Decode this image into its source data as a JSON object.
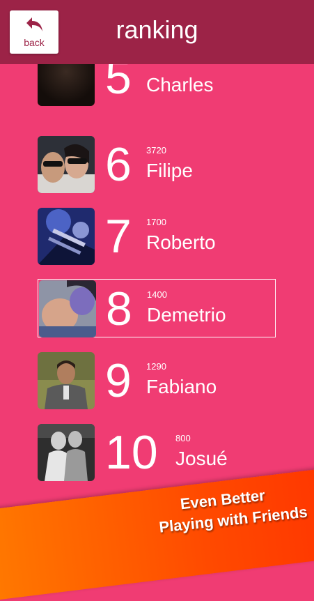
{
  "header": {
    "back_label": "back",
    "title": "ranking"
  },
  "ranking": [
    {
      "rank": "5",
      "score": "",
      "name": "Charles"
    },
    {
      "rank": "6",
      "score": "3720",
      "name": "Filipe"
    },
    {
      "rank": "7",
      "score": "1700",
      "name": "Roberto"
    },
    {
      "rank": "8",
      "score": "1400",
      "name": "Demetrio"
    },
    {
      "rank": "9",
      "score": "1290",
      "name": "Fabiano"
    },
    {
      "rank": "10",
      "score": "800",
      "name": "Josué"
    }
  ],
  "promo": {
    "line1": "Even Better",
    "line2": "Playing with Friends"
  },
  "colors": {
    "background": "#f03c73",
    "header": "#9c2347",
    "banner": "#ff5a00"
  }
}
